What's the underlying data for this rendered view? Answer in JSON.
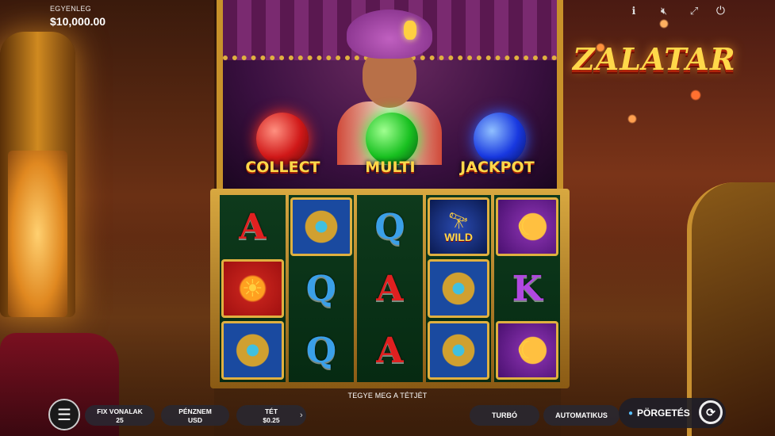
{
  "balance": {
    "label": "EGYENLEG",
    "value": "$10,000.00"
  },
  "top_icons": [
    "info-icon",
    "mute-icon",
    "fullscreen-icon",
    "power-icon"
  ],
  "logo": "ZALATAR",
  "bonus": {
    "collect": "COLLECT",
    "multi": "MULTI",
    "jackpot": "JACKPOT"
  },
  "reels": [
    [
      "A",
      "sun",
      "compass-symbol"
    ],
    [
      "compass-symbol",
      "Q",
      "Q"
    ],
    [
      "Q",
      "A",
      "A"
    ],
    [
      "WILD",
      "compass-symbol",
      "compass-symbol"
    ],
    [
      "moon",
      "K",
      "moon"
    ]
  ],
  "symbols": {
    "wild_label": "WILD"
  },
  "hint": "TEGYE MEG A TÉTJÉT",
  "controls": {
    "lines_label": "FIX VONALAK",
    "lines_value": "25",
    "currency_label": "PÉNZNEM",
    "currency_value": "USD",
    "bet_label": "TÉT",
    "bet_value": "$0.25",
    "turbo": "TURBÓ",
    "auto": "AUTOMATIKUS",
    "spin": "PÖRGETÉS"
  }
}
